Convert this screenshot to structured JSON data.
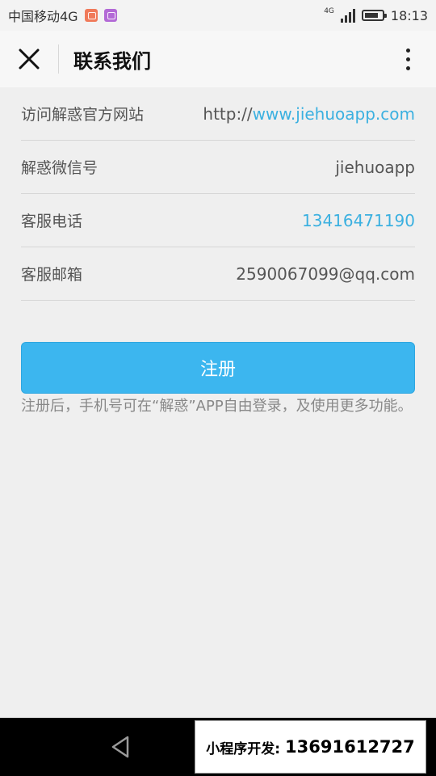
{
  "status_bar": {
    "carrier": "中国移动4G",
    "network_tag": "4G",
    "time": "18:13"
  },
  "header": {
    "title": "联系我们",
    "close_icon": "close-icon",
    "more_icon": "more-vertical-icon"
  },
  "info_rows": [
    {
      "label": "访问解惑官方网站",
      "value_prefix": "http://",
      "value_link": "www.jiehuoapp.com"
    },
    {
      "label": "解惑微信号",
      "value": "jiehuoapp"
    },
    {
      "label": "客服电话",
      "value_link": "13416471190"
    },
    {
      "label": "客服邮箱",
      "value": "2590067099@qq.com"
    }
  ],
  "register": {
    "label": "注册",
    "note": "注册后，手机号可在“解惑”APP自由登录，及使用更多功能。"
  },
  "nav": {
    "back_icon": "back-triangle-icon"
  },
  "promo": {
    "label": "小程序开发:",
    "phone": "13691612727"
  },
  "colors": {
    "accent": "#3cb6ef",
    "link": "#3bb0e0",
    "background": "#efefef"
  }
}
